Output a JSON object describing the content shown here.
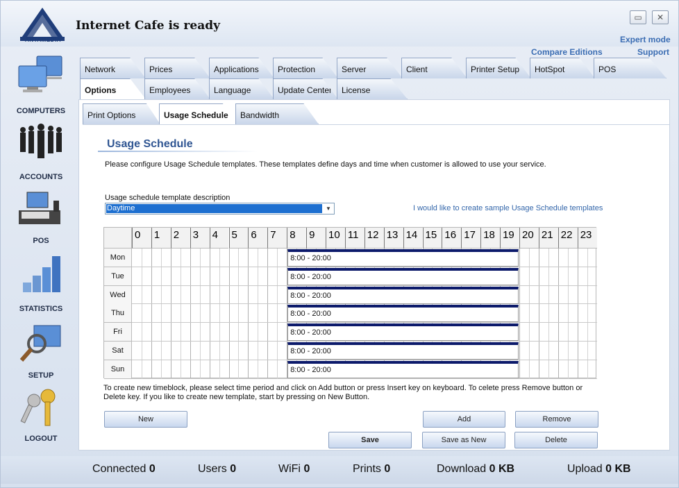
{
  "app": {
    "status_title": "Internet Cafe is ready",
    "logo_text": "ANTAMEDIA",
    "expert_mode": "Expert mode",
    "compare_editions": "Compare Editions",
    "support": "Support",
    "colors": {
      "accent": "#2f5592",
      "link": "#3b6db3",
      "block_top": "#0c1a6b",
      "selection": "#1d6fd0"
    }
  },
  "sidebar": {
    "items": [
      {
        "label": "COMPUTERS",
        "icon": "computers-icon"
      },
      {
        "label": "ACCOUNTS",
        "icon": "accounts-icon"
      },
      {
        "label": "POS",
        "icon": "pos-icon"
      },
      {
        "label": "STATISTICS",
        "icon": "statistics-icon"
      },
      {
        "label": "SETUP",
        "icon": "setup-icon"
      },
      {
        "label": "LOGOUT",
        "icon": "keys-icon"
      }
    ]
  },
  "tabs": {
    "row1": [
      "Network",
      "Prices",
      "Applications",
      "Protection",
      "Server",
      "Client",
      "Printer Setup",
      "HotSpot",
      "POS"
    ],
    "row2": [
      "Options",
      "Employees",
      "Language",
      "Update Center",
      "License"
    ],
    "sub": [
      "Print Options",
      "Usage Schedule",
      "Bandwidth"
    ],
    "active_row2": "Options",
    "active_sub": "Usage Schedule"
  },
  "page": {
    "title": "Usage Schedule",
    "description": "Please configure Usage Schedule templates. These templates define days and time when customer is allowed to use your service.",
    "template_label": "Usage schedule template description",
    "template_value": "Daytime",
    "sample_link": "I would like to create sample Usage Schedule templates",
    "help_text": "To create new timeblock, please select time period and click on Add button or press Insert key on keyboard. To celete press Remove button or Delete key. If you like to create new template, start by pressing on New Button."
  },
  "schedule": {
    "hours": [
      "0",
      "1",
      "2",
      "3",
      "4",
      "5",
      "6",
      "7",
      "8",
      "9",
      "10",
      "11",
      "12",
      "13",
      "14",
      "15",
      "16",
      "17",
      "18",
      "19",
      "20",
      "21",
      "22",
      "23"
    ],
    "days": [
      {
        "day": "Mon",
        "block": "8:00 - 20:00",
        "start": 8,
        "end": 20
      },
      {
        "day": "Tue",
        "block": "8:00 - 20:00",
        "start": 8,
        "end": 20
      },
      {
        "day": "Wed",
        "block": "8:00 - 20:00",
        "start": 8,
        "end": 20
      },
      {
        "day": "Thu",
        "block": "8:00 - 20:00",
        "start": 8,
        "end": 20
      },
      {
        "day": "Fri",
        "block": "8:00 - 20:00",
        "start": 8,
        "end": 20
      },
      {
        "day": "Sat",
        "block": "8:00 - 20:00",
        "start": 8,
        "end": 20
      },
      {
        "day": "Sun",
        "block": "8:00 - 20:00",
        "start": 8,
        "end": 20
      }
    ]
  },
  "buttons": {
    "new": "New",
    "add": "Add",
    "remove": "Remove",
    "save": "Save",
    "save_as_new": "Save as New",
    "delete": "Delete"
  },
  "statusbar": {
    "connected_label": "Connected",
    "connected": "0",
    "users_label": "Users",
    "users": "0",
    "wifi_label": "WiFi",
    "wifi": "0",
    "prints_label": "Prints",
    "prints": "0",
    "download_label": "Download",
    "download": "0 KB",
    "upload_label": "Upload",
    "upload": "0 KB"
  }
}
